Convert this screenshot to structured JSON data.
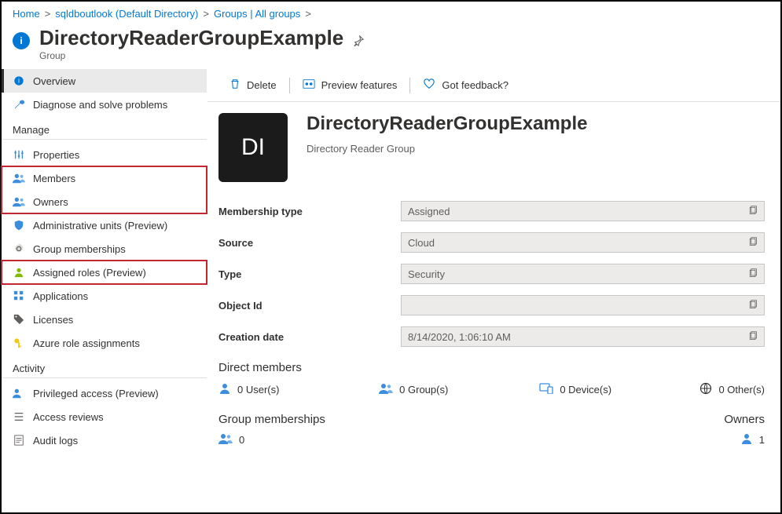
{
  "breadcrumb": {
    "items": [
      "Home",
      "sqldboutlook (Default Directory)",
      "Groups | All groups"
    ]
  },
  "header": {
    "title": "DirectoryReaderGroupExample",
    "subtitle": "Group"
  },
  "sidebar": {
    "overview": "Overview",
    "diagnose": "Diagnose and solve problems",
    "section_manage": "Manage",
    "properties": "Properties",
    "members": "Members",
    "owners": "Owners",
    "admin_units": "Administrative units (Preview)",
    "group_memberships": "Group memberships",
    "assigned_roles": "Assigned roles (Preview)",
    "applications": "Applications",
    "licenses": "Licenses",
    "azure_role": "Azure role assignments",
    "section_activity": "Activity",
    "privileged": "Privileged access (Preview)",
    "access_reviews": "Access reviews",
    "audit_logs": "Audit logs"
  },
  "toolbar": {
    "delete": "Delete",
    "preview": "Preview features",
    "feedback": "Got feedback?"
  },
  "group": {
    "avatar": "DI",
    "title": "DirectoryReaderGroupExample",
    "subtitle": "Directory Reader Group"
  },
  "props": {
    "membership_label": "Membership type",
    "membership_value": "Assigned",
    "source_label": "Source",
    "source_value": "Cloud",
    "type_label": "Type",
    "type_value": "Security",
    "object_label": "Object Id",
    "object_value": "",
    "creation_label": "Creation date",
    "creation_value": "8/14/2020, 1:06:10 AM"
  },
  "direct": {
    "heading": "Direct members",
    "users": "0 User(s)",
    "groups": "0 Group(s)",
    "devices": "0 Device(s)",
    "other": "0 Other(s)"
  },
  "gm": {
    "heading": "Group memberships",
    "value": "0",
    "owners_label": "Owners",
    "owners_value": "1"
  },
  "icons": {
    "user_blue": "#3b8ede",
    "user_green": "#7fba00",
    "key_yellow": "#f2c811",
    "wrench_blue": "#3b8ede",
    "heart": "#0078d4"
  }
}
